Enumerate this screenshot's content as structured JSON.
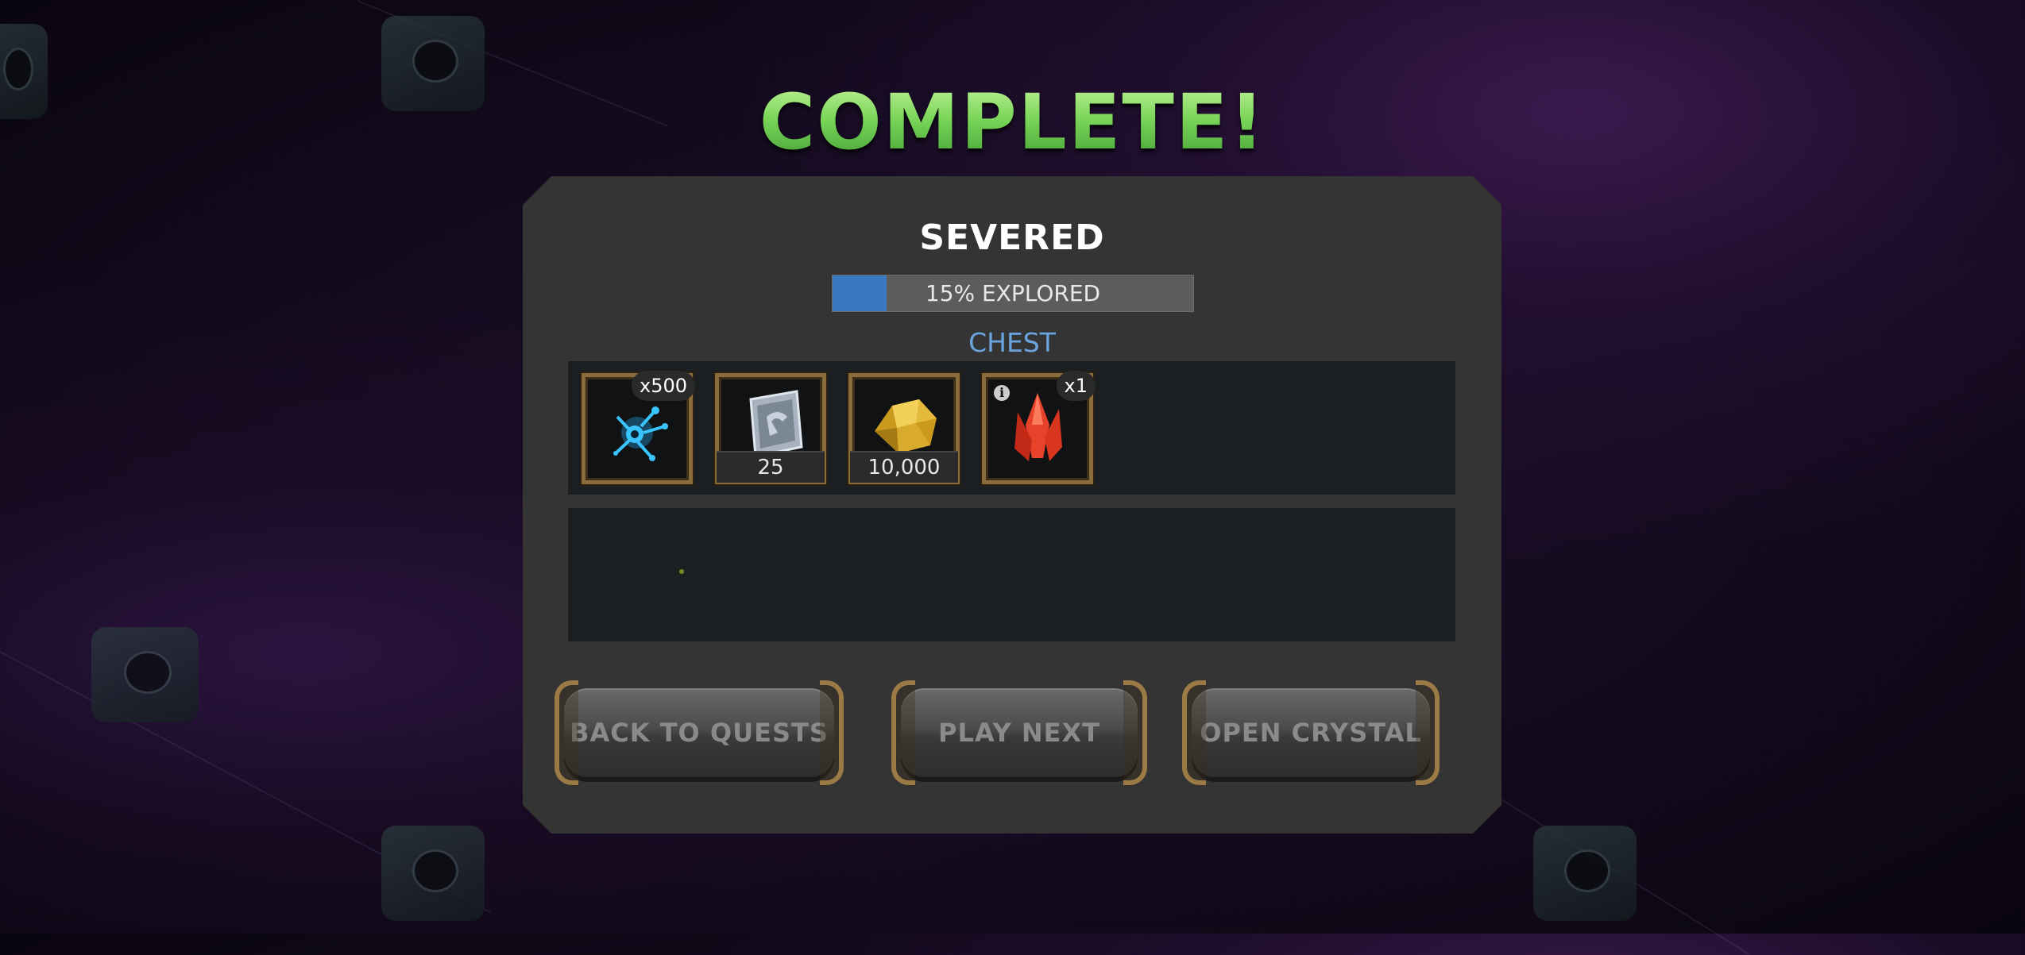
{
  "screen": {
    "title": "COMPLETE!",
    "quest_name": "SEVERED",
    "progress": {
      "percent": 15,
      "label": "15% EXPLORED"
    },
    "chest_label": "CHEST"
  },
  "rewards": [
    {
      "icon": "catalyst-fragment-icon",
      "badge": "x500",
      "count": null
    },
    {
      "icon": "silver-sigil-icon",
      "badge": null,
      "count": "25"
    },
    {
      "icon": "gold-ore-icon",
      "badge": null,
      "count": "10,000"
    },
    {
      "icon": "red-crystal-icon",
      "badge": "x1",
      "count": null,
      "info": true
    }
  ],
  "buttons": {
    "back": "BACK TO QUESTS",
    "next": "PLAY NEXT",
    "open": "OPEN CRYSTAL"
  },
  "colors": {
    "title_green": "#7bd65a",
    "progress_fill": "#3a78c0",
    "chest_blue": "#6aa3de",
    "panel": "#343434",
    "frame_gold": "#8a6d3b"
  }
}
